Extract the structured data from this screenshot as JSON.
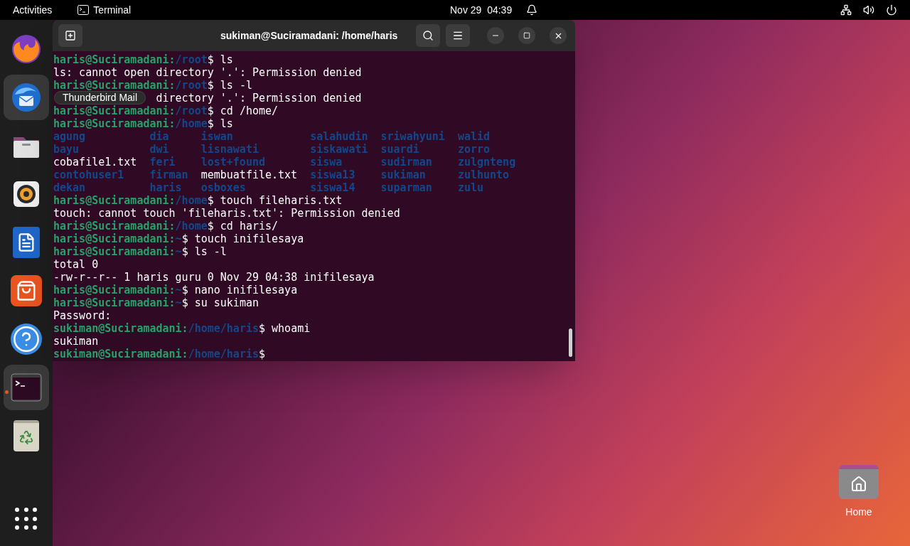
{
  "top_bar": {
    "activities": "Activities",
    "app_name": "Terminal",
    "date": "Nov 29",
    "time": "04:39"
  },
  "dock": {
    "tooltip": "Thunderbird Mail",
    "items": [
      {
        "kind": "firefox",
        "highlighted": false,
        "running": false
      },
      {
        "kind": "thunderbird",
        "highlighted": true,
        "running": false
      },
      {
        "kind": "files",
        "highlighted": false,
        "running": false
      },
      {
        "kind": "rhythmbox",
        "highlighted": false,
        "running": false
      },
      {
        "kind": "writer",
        "highlighted": false,
        "running": false
      },
      {
        "kind": "software",
        "highlighted": false,
        "running": false
      },
      {
        "kind": "help",
        "highlighted": false,
        "running": false
      },
      {
        "kind": "terminal",
        "highlighted": true,
        "running": true
      },
      {
        "kind": "trash",
        "highlighted": false,
        "running": false
      }
    ]
  },
  "window": {
    "title": "sukiman@Suciramadani: /home/haris"
  },
  "terminal": {
    "lines": [
      {
        "kind": "prompt",
        "user": "haris@Suciramadani:",
        "path": "/root",
        "command": "$ ls"
      },
      {
        "kind": "output",
        "text": "ls: cannot open directory '.': Permission denied"
      },
      {
        "kind": "prompt",
        "user": "haris@Suciramadani:",
        "path": "/root",
        "command": "$ ls -l"
      },
      {
        "kind": "covered",
        "text": "directory '.': Permission denied"
      },
      {
        "kind": "prompt",
        "user": "haris@Suciramadani:",
        "path": "/root",
        "command": "$ cd /home/"
      },
      {
        "kind": "prompt",
        "user": "haris@Suciramadani:",
        "path": "/home",
        "command": "$ ls"
      },
      {
        "kind": "listing",
        "entries": [
          {
            "text": "agung",
            "kind": "dir"
          },
          {
            "text": "dia",
            "kind": "dir"
          },
          {
            "text": "iswan",
            "kind": "dir"
          },
          {
            "text": "salahudin",
            "kind": "dir"
          },
          {
            "text": "sriwahyuni",
            "kind": "dir"
          },
          {
            "text": "walid",
            "kind": "dir"
          },
          {
            "text": "bayu",
            "kind": "dir"
          },
          {
            "text": "dwi",
            "kind": "dir"
          },
          {
            "text": "lisnawati",
            "kind": "dir"
          },
          {
            "text": "siskawati",
            "kind": "dir"
          },
          {
            "text": "suardi",
            "kind": "dir"
          },
          {
            "text": "zorro",
            "kind": "dir"
          },
          {
            "text": "cobafile1.txt",
            "kind": "file"
          },
          {
            "text": "feri",
            "kind": "dir"
          },
          {
            "text": "lost+found",
            "kind": "dir"
          },
          {
            "text": "siswa",
            "kind": "dir"
          },
          {
            "text": "sudirman",
            "kind": "dir"
          },
          {
            "text": "zulgnteng",
            "kind": "dir"
          },
          {
            "text": "contohuser1",
            "kind": "dir"
          },
          {
            "text": "firman",
            "kind": "dir"
          },
          {
            "text": "membuatfile.txt",
            "kind": "file"
          },
          {
            "text": "siswa13",
            "kind": "dir"
          },
          {
            "text": "sukiman",
            "kind": "dir"
          },
          {
            "text": "zulhunto",
            "kind": "dir"
          },
          {
            "text": "dekan",
            "kind": "dir"
          },
          {
            "text": "haris",
            "kind": "dir"
          },
          {
            "text": "osboxes",
            "kind": "dir"
          },
          {
            "text": "siswa14",
            "kind": "dir"
          },
          {
            "text": "suparman",
            "kind": "dir"
          },
          {
            "text": "zulu",
            "kind": "dir"
          }
        ]
      },
      {
        "kind": "prompt",
        "user": "haris@Suciramadani:",
        "path": "/home",
        "command": "$ touch fileharis.txt"
      },
      {
        "kind": "output",
        "text": "touch: cannot touch 'fileharis.txt': Permission denied"
      },
      {
        "kind": "prompt",
        "user": "haris@Suciramadani:",
        "path": "/home",
        "command": "$ cd haris/"
      },
      {
        "kind": "prompt",
        "user": "haris@Suciramadani:",
        "path": "~",
        "command": "$ touch inifilesaya"
      },
      {
        "kind": "prompt",
        "user": "haris@Suciramadani:",
        "path": "~",
        "command": "$ ls -l"
      },
      {
        "kind": "output",
        "text": "total 0"
      },
      {
        "kind": "output",
        "text": "-rw-r--r-- 1 haris guru 0 Nov 29 04:38 inifilesaya"
      },
      {
        "kind": "prompt",
        "user": "haris@Suciramadani:",
        "path": "~",
        "command": "$ nano inifilesaya"
      },
      {
        "kind": "prompt",
        "user": "haris@Suciramadani:",
        "path": "~",
        "command": "$ su sukiman"
      },
      {
        "kind": "output",
        "text": "Password:"
      },
      {
        "kind": "prompt",
        "user": "sukiman@Suciramadani:",
        "path": "/home/haris",
        "command": "$ whoami"
      },
      {
        "kind": "output",
        "text": "sukiman"
      },
      {
        "kind": "prompt",
        "user": "sukiman@Suciramadani:",
        "path": "/home/haris",
        "command": "$"
      }
    ]
  },
  "desktop": {
    "home_label": "Home"
  }
}
